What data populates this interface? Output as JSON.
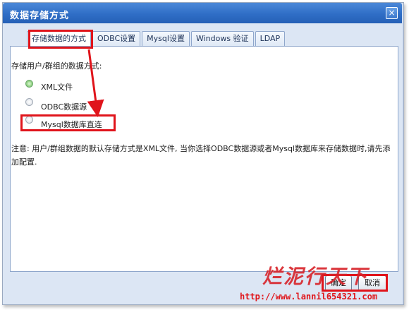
{
  "window": {
    "title": "数据存储方式",
    "close_symbol": "×"
  },
  "tabs": [
    {
      "label": "存储数据的方式"
    },
    {
      "label": "ODBC设置"
    },
    {
      "label": "Mysql设置"
    },
    {
      "label": "Windows 验证"
    },
    {
      "label": "LDAP"
    }
  ],
  "section": {
    "label": "存储用户/群组的数据方式:"
  },
  "options": [
    {
      "label": "XML文件",
      "checked": true
    },
    {
      "label": "ODBC数据源",
      "checked": false
    },
    {
      "label": "Mysql数据库直连",
      "checked": false
    }
  ],
  "note": {
    "text": "注意: 用户/群组数据的默认存储方式是XML文件, 当你选择ODBC数据源或者Mysql数据库来存储数据时,请先添加配置."
  },
  "buttons": {
    "ok_label": "确定",
    "cancel_label": "取消"
  },
  "watermark": {
    "text": "烂泥行天下",
    "url": "http://www.lannil654321.com"
  },
  "colors": {
    "title_bar": "#2f6ec6",
    "highlight": "#e0141b",
    "panel_bg": "#ffffff"
  }
}
